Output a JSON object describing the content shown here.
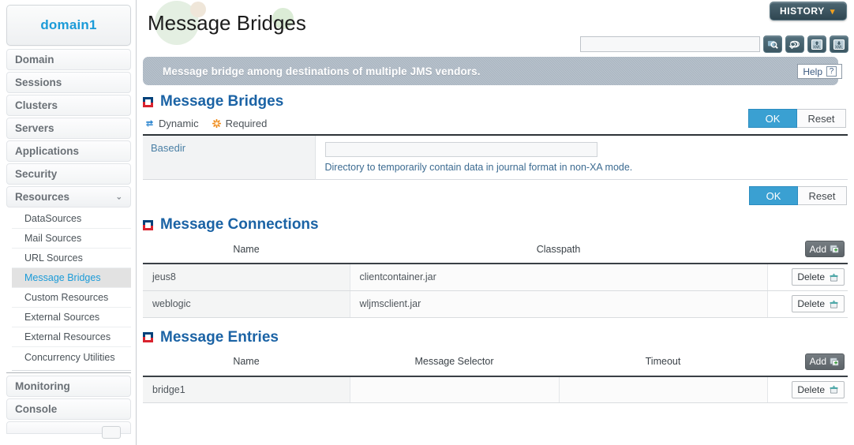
{
  "sidebar": {
    "domain_label": "domain1",
    "items": [
      {
        "label": "Domain",
        "name": "domain"
      },
      {
        "label": "Sessions",
        "name": "sessions"
      },
      {
        "label": "Clusters",
        "name": "clusters"
      },
      {
        "label": "Servers",
        "name": "servers"
      },
      {
        "label": "Applications",
        "name": "applications"
      },
      {
        "label": "Security",
        "name": "security"
      }
    ],
    "resources": {
      "label": "Resources",
      "chevron": "⌄"
    },
    "sub_items": [
      {
        "label": "DataSources",
        "active": false
      },
      {
        "label": "Mail Sources",
        "active": false
      },
      {
        "label": "URL Sources",
        "active": false
      },
      {
        "label": "Message Bridges",
        "active": true
      },
      {
        "label": "Custom Resources",
        "active": false
      },
      {
        "label": "External Sources",
        "active": false
      },
      {
        "label": "External Resources",
        "active": false
      },
      {
        "label": "Concurrency Utilities",
        "active": false
      }
    ],
    "bottom_items": [
      {
        "label": "Monitoring",
        "name": "monitoring"
      },
      {
        "label": "Console",
        "name": "console"
      }
    ]
  },
  "header": {
    "page_title": "Message Bridges",
    "history_label": "HISTORY",
    "history_chevron": "▾",
    "search_value": "",
    "search_placeholder": "",
    "toolbar_icons": [
      "search-icon",
      "reload-icon",
      "xml-import-icon",
      "xml-export-icon"
    ],
    "banner_text": "Message bridge among destinations of multiple JMS vendors.",
    "help_label": "Help",
    "help_glyph": "?"
  },
  "message_bridges": {
    "section_title": "Message Bridges",
    "legend": [
      {
        "label": "Dynamic",
        "icon": "dynamic-icon",
        "color": "#2f87d0"
      },
      {
        "label": "Required",
        "icon": "required-icon",
        "color": "#f08a18"
      }
    ],
    "field_label": "Basedir",
    "field_value": "",
    "field_hint": "Directory to temporarily contain data in journal format in non-XA mode.",
    "ok_label": "OK",
    "reset_label": "Reset"
  },
  "message_connections": {
    "section_title": "Message Connections",
    "columns": [
      "Name",
      "Classpath"
    ],
    "add_label": "Add",
    "delete_label": "Delete",
    "rows": [
      {
        "name": "jeus8",
        "classpath": "clientcontainer.jar"
      },
      {
        "name": "weblogic",
        "classpath": "wljmsclient.jar"
      }
    ]
  },
  "message_entries": {
    "section_title": "Message Entries",
    "columns": [
      "Name",
      "Message Selector",
      "Timeout"
    ],
    "add_label": "Add",
    "delete_label": "Delete",
    "rows": [
      {
        "name": "bridge1",
        "selector": "",
        "timeout": ""
      }
    ]
  },
  "colors": {
    "accent_blue": "#1b9bd8",
    "section_heading": "#1b63a5",
    "ok_button": "#3aa0d2",
    "banner": "#a8b4c0",
    "history": "#2f4651",
    "required": "#f08a18"
  }
}
